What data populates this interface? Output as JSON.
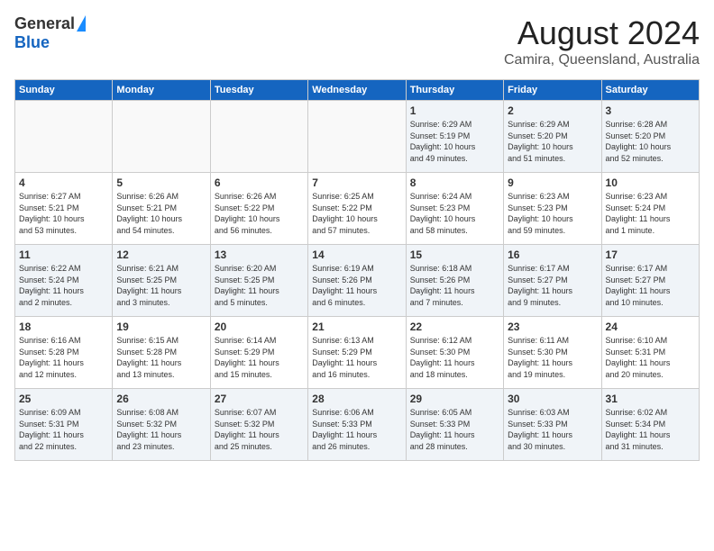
{
  "header": {
    "logo_general": "General",
    "logo_blue": "Blue",
    "month_title": "August 2024",
    "subtitle": "Camira, Queensland, Australia"
  },
  "days_of_week": [
    "Sunday",
    "Monday",
    "Tuesday",
    "Wednesday",
    "Thursday",
    "Friday",
    "Saturday"
  ],
  "weeks": [
    [
      {
        "day": "",
        "info": ""
      },
      {
        "day": "",
        "info": ""
      },
      {
        "day": "",
        "info": ""
      },
      {
        "day": "",
        "info": ""
      },
      {
        "day": "1",
        "info": "Sunrise: 6:29 AM\nSunset: 5:19 PM\nDaylight: 10 hours\nand 49 minutes."
      },
      {
        "day": "2",
        "info": "Sunrise: 6:29 AM\nSunset: 5:20 PM\nDaylight: 10 hours\nand 51 minutes."
      },
      {
        "day": "3",
        "info": "Sunrise: 6:28 AM\nSunset: 5:20 PM\nDaylight: 10 hours\nand 52 minutes."
      }
    ],
    [
      {
        "day": "4",
        "info": "Sunrise: 6:27 AM\nSunset: 5:21 PM\nDaylight: 10 hours\nand 53 minutes."
      },
      {
        "day": "5",
        "info": "Sunrise: 6:26 AM\nSunset: 5:21 PM\nDaylight: 10 hours\nand 54 minutes."
      },
      {
        "day": "6",
        "info": "Sunrise: 6:26 AM\nSunset: 5:22 PM\nDaylight: 10 hours\nand 56 minutes."
      },
      {
        "day": "7",
        "info": "Sunrise: 6:25 AM\nSunset: 5:22 PM\nDaylight: 10 hours\nand 57 minutes."
      },
      {
        "day": "8",
        "info": "Sunrise: 6:24 AM\nSunset: 5:23 PM\nDaylight: 10 hours\nand 58 minutes."
      },
      {
        "day": "9",
        "info": "Sunrise: 6:23 AM\nSunset: 5:23 PM\nDaylight: 10 hours\nand 59 minutes."
      },
      {
        "day": "10",
        "info": "Sunrise: 6:23 AM\nSunset: 5:24 PM\nDaylight: 11 hours\nand 1 minute."
      }
    ],
    [
      {
        "day": "11",
        "info": "Sunrise: 6:22 AM\nSunset: 5:24 PM\nDaylight: 11 hours\nand 2 minutes."
      },
      {
        "day": "12",
        "info": "Sunrise: 6:21 AM\nSunset: 5:25 PM\nDaylight: 11 hours\nand 3 minutes."
      },
      {
        "day": "13",
        "info": "Sunrise: 6:20 AM\nSunset: 5:25 PM\nDaylight: 11 hours\nand 5 minutes."
      },
      {
        "day": "14",
        "info": "Sunrise: 6:19 AM\nSunset: 5:26 PM\nDaylight: 11 hours\nand 6 minutes."
      },
      {
        "day": "15",
        "info": "Sunrise: 6:18 AM\nSunset: 5:26 PM\nDaylight: 11 hours\nand 7 minutes."
      },
      {
        "day": "16",
        "info": "Sunrise: 6:17 AM\nSunset: 5:27 PM\nDaylight: 11 hours\nand 9 minutes."
      },
      {
        "day": "17",
        "info": "Sunrise: 6:17 AM\nSunset: 5:27 PM\nDaylight: 11 hours\nand 10 minutes."
      }
    ],
    [
      {
        "day": "18",
        "info": "Sunrise: 6:16 AM\nSunset: 5:28 PM\nDaylight: 11 hours\nand 12 minutes."
      },
      {
        "day": "19",
        "info": "Sunrise: 6:15 AM\nSunset: 5:28 PM\nDaylight: 11 hours\nand 13 minutes."
      },
      {
        "day": "20",
        "info": "Sunrise: 6:14 AM\nSunset: 5:29 PM\nDaylight: 11 hours\nand 15 minutes."
      },
      {
        "day": "21",
        "info": "Sunrise: 6:13 AM\nSunset: 5:29 PM\nDaylight: 11 hours\nand 16 minutes."
      },
      {
        "day": "22",
        "info": "Sunrise: 6:12 AM\nSunset: 5:30 PM\nDaylight: 11 hours\nand 18 minutes."
      },
      {
        "day": "23",
        "info": "Sunrise: 6:11 AM\nSunset: 5:30 PM\nDaylight: 11 hours\nand 19 minutes."
      },
      {
        "day": "24",
        "info": "Sunrise: 6:10 AM\nSunset: 5:31 PM\nDaylight: 11 hours\nand 20 minutes."
      }
    ],
    [
      {
        "day": "25",
        "info": "Sunrise: 6:09 AM\nSunset: 5:31 PM\nDaylight: 11 hours\nand 22 minutes."
      },
      {
        "day": "26",
        "info": "Sunrise: 6:08 AM\nSunset: 5:32 PM\nDaylight: 11 hours\nand 23 minutes."
      },
      {
        "day": "27",
        "info": "Sunrise: 6:07 AM\nSunset: 5:32 PM\nDaylight: 11 hours\nand 25 minutes."
      },
      {
        "day": "28",
        "info": "Sunrise: 6:06 AM\nSunset: 5:33 PM\nDaylight: 11 hours\nand 26 minutes."
      },
      {
        "day": "29",
        "info": "Sunrise: 6:05 AM\nSunset: 5:33 PM\nDaylight: 11 hours\nand 28 minutes."
      },
      {
        "day": "30",
        "info": "Sunrise: 6:03 AM\nSunset: 5:33 PM\nDaylight: 11 hours\nand 30 minutes."
      },
      {
        "day": "31",
        "info": "Sunrise: 6:02 AM\nSunset: 5:34 PM\nDaylight: 11 hours\nand 31 minutes."
      }
    ]
  ]
}
